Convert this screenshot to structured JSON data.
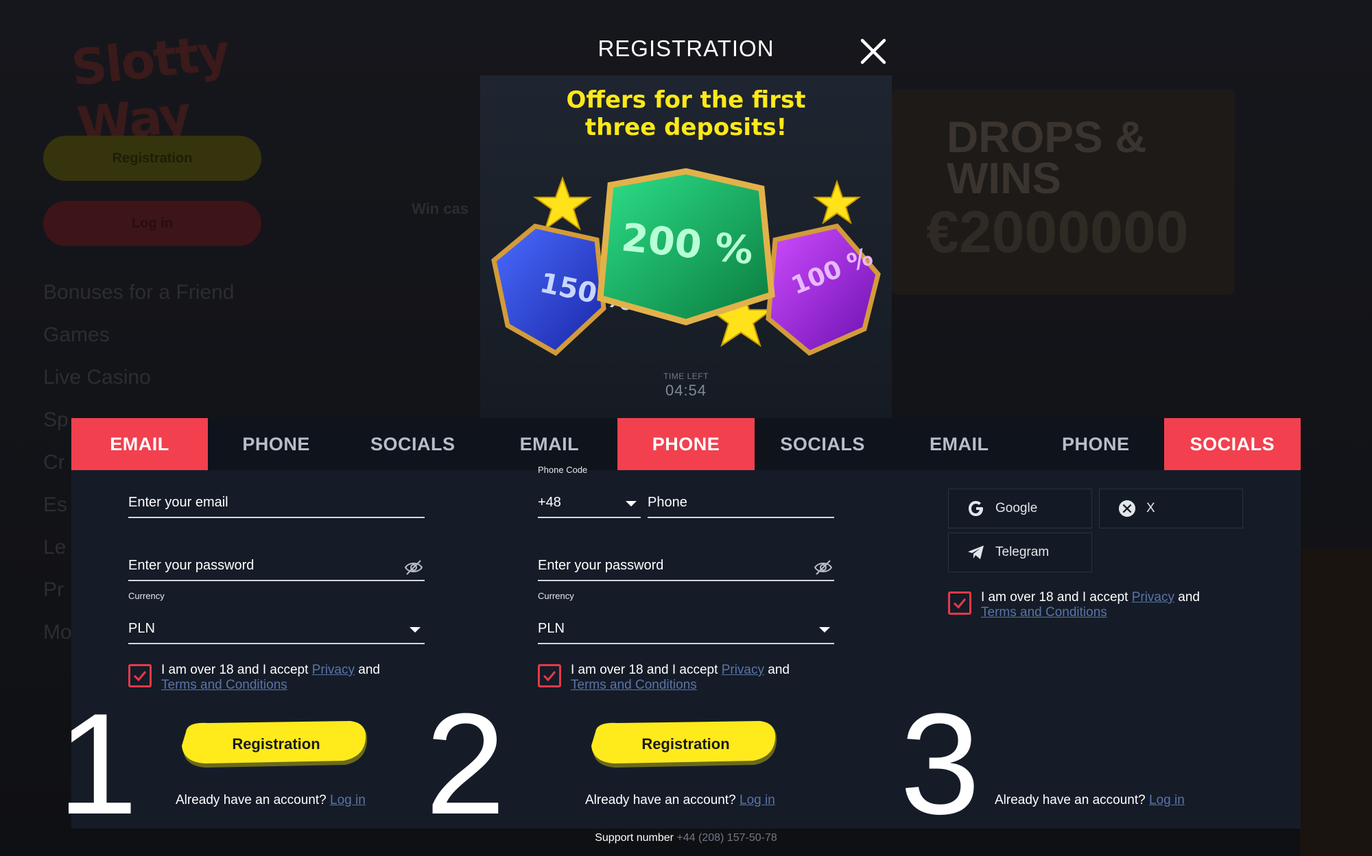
{
  "background": {
    "logo_text": "Slotty Way",
    "register_label": "Registration",
    "login_label": "Log in",
    "nav_items": [
      "Bonuses for a Friend",
      "Games",
      "Live Casino",
      "Sp",
      "Cr",
      "Es",
      "Le",
      "Pr",
      "Mo"
    ],
    "promo_text": "Win cas",
    "banner_title": "DROPS & WINS",
    "banner_amount": "€2000000"
  },
  "modal": {
    "title": "REGISTRATION",
    "close_icon": "close-icon"
  },
  "promo": {
    "headline_line1": "Offers for the first",
    "headline_line2": "three deposits!",
    "gems": [
      "150 %",
      "200 %",
      "100 %"
    ],
    "timer_label": "TIME LEFT",
    "timer_value": "04:54",
    "colors": {
      "headline": "#ffe81a",
      "gem_blue": "#2a44d6",
      "gem_green": "#17b85a",
      "gem_purple": "#a31fe0"
    }
  },
  "tabs": [
    {
      "label": "EMAIL",
      "active": true
    },
    {
      "label": "PHONE",
      "active": false
    },
    {
      "label": "SOCIALS",
      "active": false
    },
    {
      "label": "EMAIL",
      "active": false
    },
    {
      "label": "PHONE",
      "active": true
    },
    {
      "label": "SOCIALS",
      "active": false
    },
    {
      "label": "EMAIL",
      "active": false
    },
    {
      "label": "PHONE",
      "active": false
    },
    {
      "label": "SOCIALS",
      "active": true
    }
  ],
  "email_form": {
    "email_placeholder": "Enter your email",
    "password_placeholder": "Enter your password",
    "currency_caption": "Currency",
    "currency_value": "PLN",
    "agree_text": "I am over 18 and I accept ",
    "privacy_link": "Privacy",
    "and_text": " and",
    "terms_link": "Terms and Conditions",
    "register_button": "Registration",
    "already_text": "Already have an account? ",
    "login_link": "Log in",
    "step_number": "1"
  },
  "phone_form": {
    "phone_code_caption": "Phone Code",
    "phone_code_value": "+48",
    "phone_placeholder": "Phone",
    "password_placeholder": "Enter your password",
    "currency_caption": "Currency",
    "currency_value": "PLN",
    "agree_text": "I am over 18 and I accept ",
    "privacy_link": "Privacy",
    "and_text": " and",
    "terms_link": "Terms and Conditions",
    "register_button": "Registration",
    "already_text": "Already have an account? ",
    "login_link": "Log in",
    "step_number": "2"
  },
  "socials_form": {
    "providers": [
      {
        "label": "Google",
        "icon": "google-icon"
      },
      {
        "label": "X",
        "icon": "x-icon"
      },
      {
        "label": "Telegram",
        "icon": "telegram-icon"
      }
    ],
    "agree_text": "I am over 18 and I accept ",
    "privacy_link": "Privacy",
    "and_text": " and",
    "terms_link": "Terms and Conditions",
    "already_text": "Already have an account? ",
    "login_link": "Log in",
    "step_number": "3"
  },
  "footer": {
    "support_label": "Support number ",
    "support_number": "+44 (208) 157-50-78"
  },
  "colors": {
    "accent_red": "#f2404f",
    "button_yellow": "#ffea1c",
    "panel": "#151c28",
    "link": "#5a74a6"
  }
}
